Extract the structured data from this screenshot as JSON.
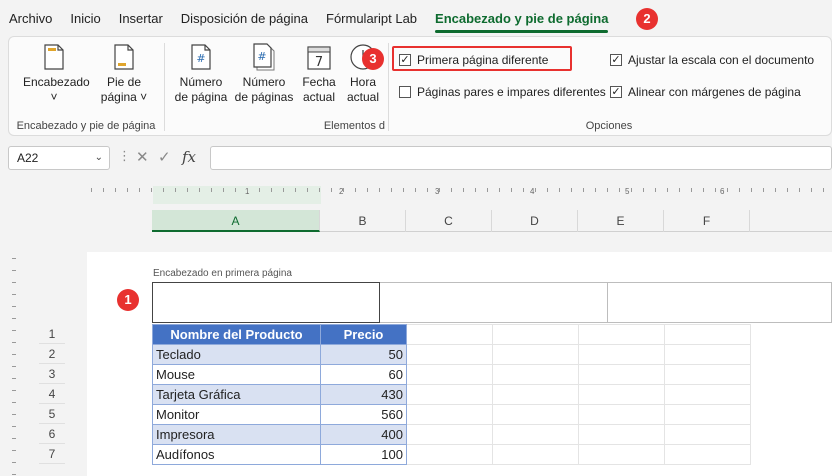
{
  "menu": {
    "tabs": [
      "Archivo",
      "Inicio",
      "Insertar",
      "Disposición de página",
      "Fórmulaript Lab",
      "Encabezado y pie de página"
    ],
    "active_index": 5
  },
  "ribbon": {
    "group1": {
      "label": "Encabezado y pie de página",
      "header_button": {
        "line1": "Encabezado",
        "line2": "˅"
      },
      "footer_button": {
        "line1": "Pie de",
        "line2": "página ˅"
      }
    },
    "group2": {
      "label": "Elementos d",
      "buttons": [
        {
          "line1": "Número",
          "line2": "de página",
          "glyph": "#"
        },
        {
          "line1": "Número",
          "line2": "de páginas",
          "glyph": "#"
        },
        {
          "line1": "Fecha",
          "line2": "actual",
          "glyph": "7"
        },
        {
          "line1": "Hora",
          "line2": "actual",
          "glyph": ""
        }
      ]
    },
    "options": {
      "label": "Opciones",
      "first_page": {
        "label": "Primera página diferente",
        "checked": true
      },
      "odd_even": {
        "label": "Páginas pares e impares diferentes",
        "checked": false
      },
      "scale": {
        "label": "Ajustar la escala con el documento",
        "checked": true
      },
      "align": {
        "label": "Alinear con márgenes de página",
        "checked": true
      }
    }
  },
  "formula_bar": {
    "name_box": "A22",
    "dropdown": "⌄",
    "dots": "⋮",
    "cancel": "✕",
    "enter": "✓",
    "fx": "fx",
    "value": ""
  },
  "ruler": {
    "marks": [
      "1",
      "2",
      "3",
      "4",
      "5",
      "6"
    ]
  },
  "columns": [
    "A",
    "B",
    "C",
    "D",
    "E",
    "F"
  ],
  "sheet": {
    "header_label": "Encabezado en primera página",
    "rows": [
      "1",
      "2",
      "3",
      "4",
      "5",
      "6",
      "7"
    ],
    "table": {
      "headers": [
        "Nombre del Producto",
        "Precio"
      ],
      "rows": [
        [
          "Teclado",
          "50"
        ],
        [
          "Mouse",
          "60"
        ],
        [
          "Tarjeta Gráfica",
          "430"
        ],
        [
          "Monitor",
          "560"
        ],
        [
          "Impresora",
          "400"
        ],
        [
          "Audífonos",
          "100"
        ]
      ]
    }
  },
  "badges": [
    "1",
    "2",
    "3"
  ],
  "colors": {
    "accent": "#0e6b2f",
    "table_header": "#4472c4",
    "band": "#d9e1f2",
    "callout": "#e8312f"
  }
}
